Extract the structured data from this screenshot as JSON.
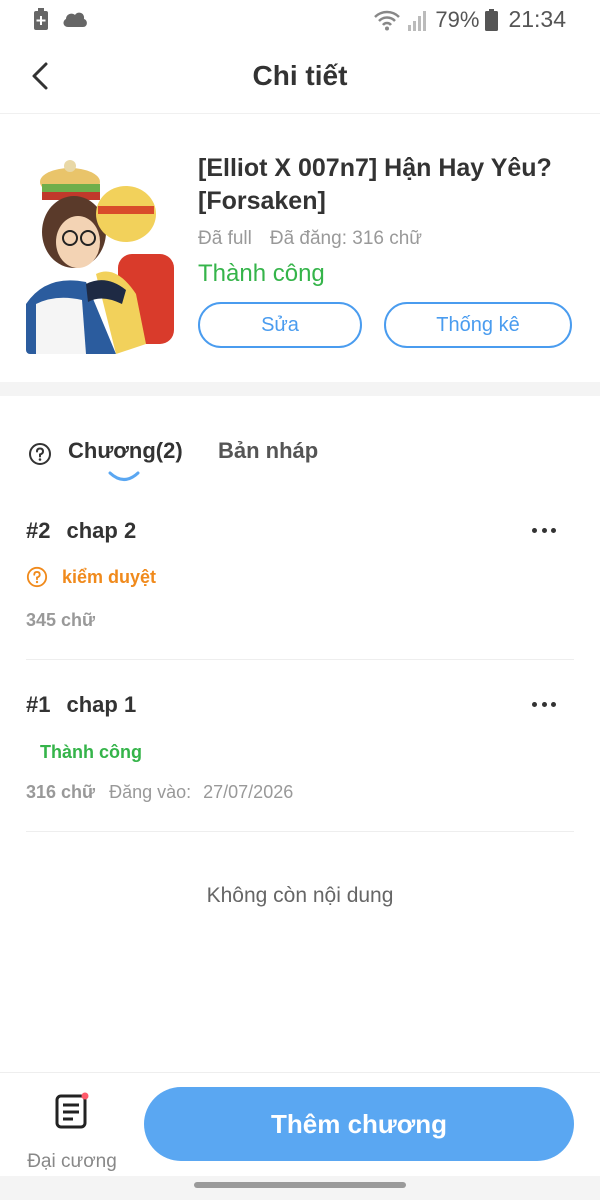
{
  "status_bar": {
    "battery_percent": "79%",
    "time": "21:34"
  },
  "header": {
    "title": "Chi tiết"
  },
  "story": {
    "title": "[Elliot X 007n7] Hận Hay Yêu? [Forsaken]",
    "status_full": "Đã full",
    "posted_words": "Đã đăng: 316 chữ",
    "result": "Thành công",
    "edit_label": "Sửa",
    "stats_label": "Thống kê"
  },
  "tabs": {
    "chapters_label": "Chương(2)",
    "drafts_label": "Bản nháp"
  },
  "chapters": [
    {
      "number": "#2",
      "title": "chap 2",
      "status": "kiểm duyệt",
      "words": "345 chữ"
    },
    {
      "number": "#1",
      "title": "chap 1",
      "status": "Thành công",
      "words": "316 chữ",
      "posted_label": "Đăng vào:",
      "posted_date": "27/07/2026"
    }
  ],
  "end_note": "Không còn nội dung",
  "bottom": {
    "outline_label": "Đại cương",
    "add_chapter_label": "Thêm chương"
  },
  "colors": {
    "accent": "#4a9cef",
    "success": "#35b44a",
    "warning": "#f08a1c",
    "primary_button": "#5aa7f2"
  }
}
